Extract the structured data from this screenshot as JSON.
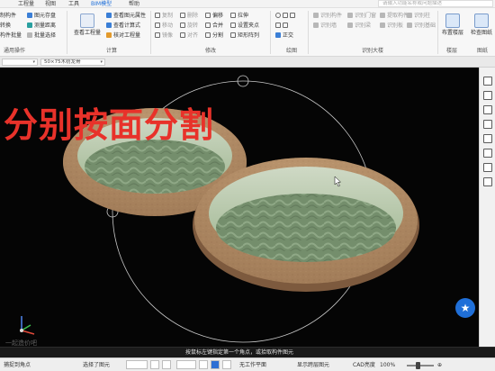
{
  "tabs": [
    "工程量",
    "视图",
    "工具",
    "BIM模型",
    "帮助"
  ],
  "search_placeholder": "请输入功能名称或问题描述",
  "ribbon": {
    "col1": [
      "构件转换",
      "复制构件",
      "构件批量"
    ],
    "col1_cut": [
      "制构件",
      "转换"
    ],
    "col2": [
      "图元存盘",
      "测量距离",
      "批量选择"
    ],
    "col3": [
      "查看图元属性",
      "查看计算式",
      "核对工程量"
    ],
    "big_calc": "查看工程量",
    "mod_col1": [
      "复制",
      "移动",
      "镜像"
    ],
    "mod_col2": [
      "删除",
      "旋转",
      "对齐"
    ],
    "mod_col3": [
      "偏移",
      "合并",
      "分割"
    ],
    "mod_col4": [
      "拉伸",
      "设置夹点",
      "矩形阵列"
    ],
    "draw_label": "绘制",
    "draw_check": "正交",
    "smart_col1": [
      "识别构件",
      "识别墙"
    ],
    "smart_col2": [
      "识别门窗",
      "识别梁"
    ],
    "smart_col3": [
      "提取构件",
      "识别板"
    ],
    "smart_col4": [
      "识别柱",
      "识别基础"
    ],
    "big_layout": "布置楼层",
    "big_check": "检查图纸",
    "group_labels": [
      "通用操作",
      "计算",
      "修改",
      "绘图",
      "识别大楼",
      "楼层",
      "图纸"
    ]
  },
  "subbar": {
    "layer_select": "",
    "component_select": "50×75木枋龙骨"
  },
  "viewport": {
    "overlay_title": "分别按面分割",
    "watermark": "一起造价吧"
  },
  "hint": "按鼠标左键指定第一个角点，或拾取构件图元",
  "status": {
    "snap": "捕捉到角点",
    "select_mode": "选择了图元",
    "workplane": "无工作平面",
    "display": "显示跨层图元",
    "cad_label": "CAD亮度",
    "cad_value": "100%"
  },
  "colors": {
    "accent": "#1e6fd9",
    "overlay_text": "#e8322a",
    "ring_outer": "#b8906a",
    "water_inner": "#7e9a78"
  }
}
